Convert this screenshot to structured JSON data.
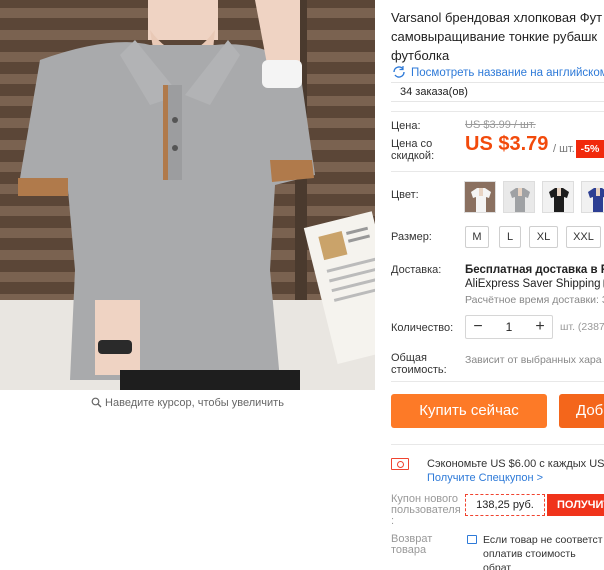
{
  "product": {
    "title": "Varsanol брендовая хлопковая Фут\nсамовыращивание тонкие рубашк\nфутболка",
    "translate_link": "Посмотреть название на английском",
    "orders": "34 заказа(ов)"
  },
  "gallery": {
    "zoom_hint": "Наведите курсор, чтобы увеличить"
  },
  "price": {
    "label": "Цена:",
    "original": "US $3.99 / шт.",
    "discount_label": "Цена со скидкой:",
    "current": "US $3.79",
    "unit": "/ шт.",
    "discount_badge": "-5%"
  },
  "options": {
    "color_label": "Цвет:",
    "colors": [
      "white-shirt",
      "grey-shirt",
      "black-shirt",
      "navy-shirt"
    ],
    "size_label": "Размер:",
    "sizes": [
      "M",
      "L",
      "XL",
      "XXL"
    ]
  },
  "shipping": {
    "label": "Доставка:",
    "title": "Бесплатная доставка в Rus",
    "method": "AliExpress Saver Shipping",
    "time": "Расчётное время доставки: 3"
  },
  "quantity": {
    "label": "Количество:",
    "minus": "−",
    "value": "1",
    "plus": "+",
    "stock": "шт. (2387"
  },
  "total": {
    "label": "Общая стоимость:",
    "note": "Зависит от выбранных хара"
  },
  "actions": {
    "buy_now": "Купить сейчас",
    "add_to_cart": "Доб"
  },
  "promo": {
    "save_text": "Сэкономьте US $6.00 с каждых US $6",
    "coupon_link": "Получите Спецкупон >",
    "coupon_label": "Купон нового пользователя :",
    "coupon_value": "138,25 руб.",
    "coupon_button": "ПОЛУЧИТ"
  },
  "returns": {
    "label": "Возврат товара",
    "text": "Если товар не соответст\nоплатив стоимость обрат\nдоговориться о компенс"
  },
  "colors": {
    "price_red": "#f24a0b",
    "buy_orange": "#fd7a27",
    "cart_orange": "#f4661b",
    "link_blue": "#2e7ad8",
    "coupon_red": "#f0331a"
  }
}
